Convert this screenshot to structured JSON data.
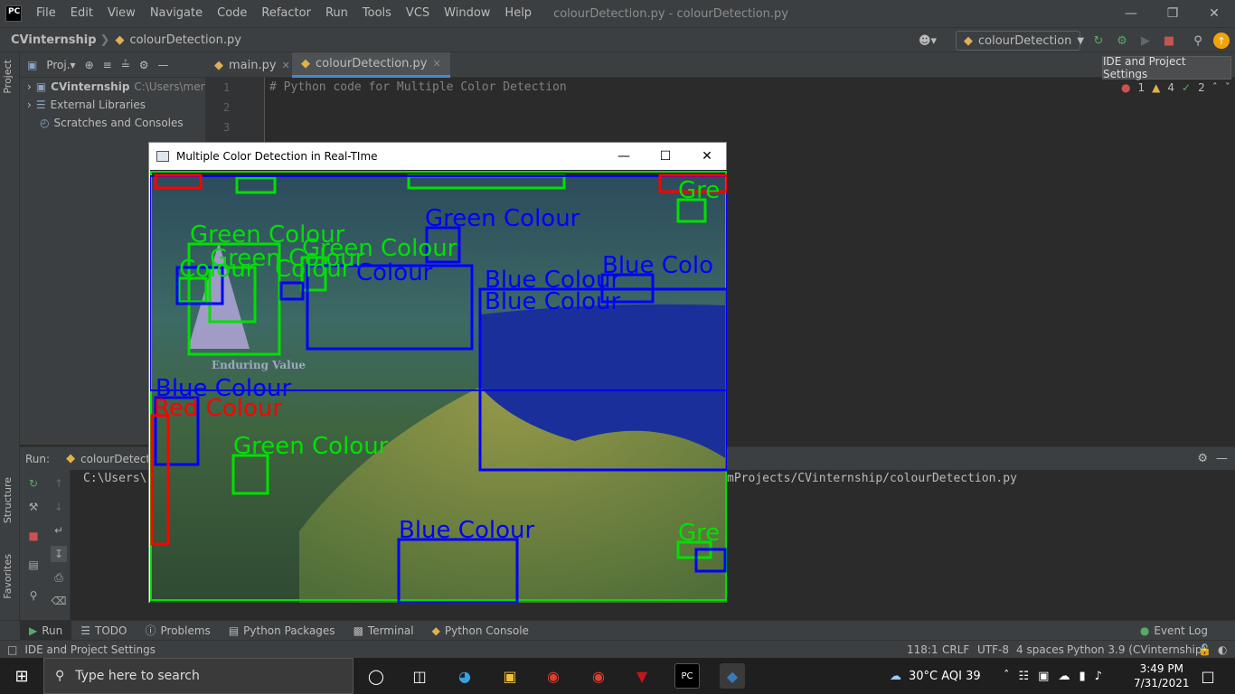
{
  "menubar": {
    "logo": "PC",
    "items": [
      "File",
      "Edit",
      "View",
      "Navigate",
      "Code",
      "Refactor",
      "Run",
      "Tools",
      "VCS",
      "Window",
      "Help"
    ],
    "title": "colourDetection.py - colourDetection.py"
  },
  "navbar": {
    "project": "CVinternship",
    "file": "colourDetection.py",
    "run_config": "colourDetection"
  },
  "left_strip": {
    "project": "Project",
    "structure": "Structure",
    "favorites": "Favorites"
  },
  "project_panel": {
    "header": "Proj.▾",
    "tree": [
      {
        "name": "CVinternship",
        "path": "C:\\Users\\menor"
      },
      {
        "name": "External Libraries",
        "path": ""
      },
      {
        "name": "Scratches and Consoles",
        "path": ""
      }
    ]
  },
  "editor": {
    "tabs": [
      "main.py",
      "colourDetection.py"
    ],
    "line_numbers": [
      "1",
      "2",
      "3"
    ],
    "code_line_1": "# Python code for Multiple Color Detection",
    "tooltip": "IDE and Project Settings",
    "inspections": {
      "errors": "1",
      "warnings": "4",
      "ok": "2"
    }
  },
  "run_panel": {
    "label": "Run:",
    "tab": "colourDetection",
    "console_left": "C:\\Users\\",
    "console_right": "mProjects/CVinternship/colourDetection.py"
  },
  "bottom_tabs": [
    "Run",
    "TODO",
    "Problems",
    "Python Packages",
    "Terminal",
    "Python Console"
  ],
  "event_log": "Event Log",
  "statusbar": {
    "left": "IDE and Project Settings",
    "position": "118:1",
    "line_sep": "CRLF",
    "encoding": "UTF-8",
    "indent": "4 spaces",
    "interpreter": "Python 3.9 (CVinternship)"
  },
  "cv_window": {
    "title": "Multiple Color Detection in Real-TIme",
    "labels": {
      "green": "Green  Colour",
      "blue": "Blue  Colour",
      "red": "Red  Colour",
      "colour": "Colour",
      "gre": "Gre",
      "green_cut": "Green  C",
      "blue_cut": "Blue  Colo",
      "logo_text": "Enduring Value"
    },
    "colors": {
      "green": "#00e000",
      "blue": "#0000ff",
      "red": "#ff0000"
    }
  },
  "taskbar": {
    "search_placeholder": "Type here to search",
    "weather": "30°C  AQI 39",
    "time": "3:49 PM",
    "date": "7/31/2021"
  }
}
